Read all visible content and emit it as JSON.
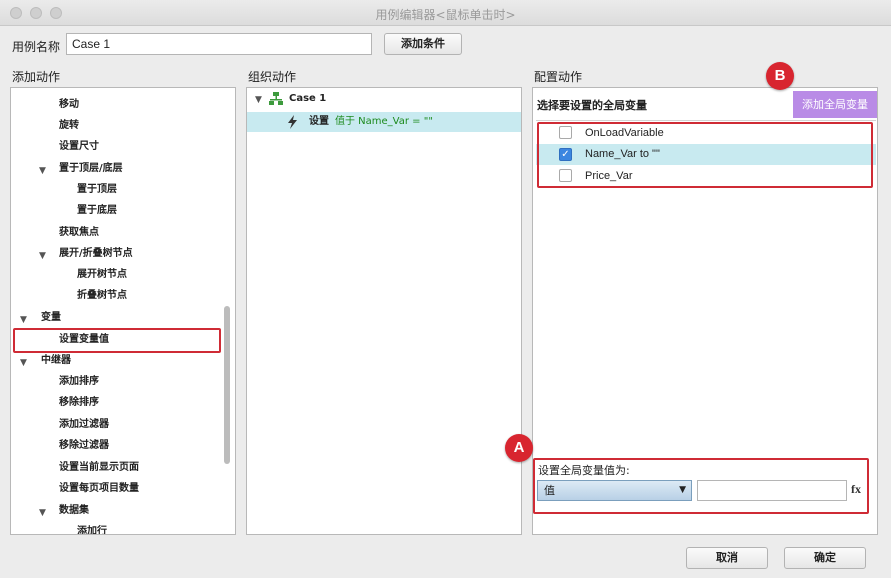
{
  "window": {
    "title": "用例编辑器<鼠标单击时>"
  },
  "case_name": {
    "label": "用例名称",
    "value": "Case 1"
  },
  "add_condition_label": "添加条件",
  "columns": {
    "add_action": "添加动作",
    "organize_action": "组织动作",
    "configure_action": "配置动作"
  },
  "action_tree": {
    "items": [
      {
        "label": "移动"
      },
      {
        "label": "旋转"
      },
      {
        "label": "设置尺寸"
      },
      {
        "label": "置于顶层/底层",
        "expanded": true
      },
      {
        "label": "置于顶层"
      },
      {
        "label": "置于底层"
      },
      {
        "label": "获取焦点"
      },
      {
        "label": "展开/折叠树节点",
        "expanded": true
      },
      {
        "label": "展开树节点"
      },
      {
        "label": "折叠树节点"
      },
      {
        "label": "变量",
        "expanded": true
      },
      {
        "label": "设置变量值",
        "highlighted": true
      },
      {
        "label": "中继器",
        "expanded": true
      },
      {
        "label": "添加排序"
      },
      {
        "label": "移除排序"
      },
      {
        "label": "添加过滤器"
      },
      {
        "label": "移除过滤器"
      },
      {
        "label": "设置当前显示页面"
      },
      {
        "label": "设置每页项目数量"
      },
      {
        "label": "数据集",
        "expanded": true
      },
      {
        "label": "添加行"
      }
    ]
  },
  "organize": {
    "case_label": "Case 1",
    "action_prefix": "设置",
    "action_detail": "值于 Name_Var = \"\""
  },
  "configure": {
    "select_vars_label": "选择要设置的全局变量",
    "add_global_var_label": "添加全局变量",
    "variables": [
      {
        "name": "OnLoadVariable",
        "checked": false
      },
      {
        "name": "Name_Var to \"\"",
        "checked": true
      },
      {
        "name": "Price_Var",
        "checked": false
      }
    ],
    "set_value_label": "设置全局变量值为:",
    "value_type": "值",
    "value_input": "",
    "fx_label": "fx"
  },
  "badges": {
    "a": "A",
    "b": "B"
  },
  "buttons": {
    "cancel": "取消",
    "ok": "确定"
  },
  "colors": {
    "highlight_red": "#cf2b35",
    "selection_cyan": "#c8eaf0",
    "purple_button": "#b98be6",
    "checkbox_blue": "#3b86e0"
  }
}
